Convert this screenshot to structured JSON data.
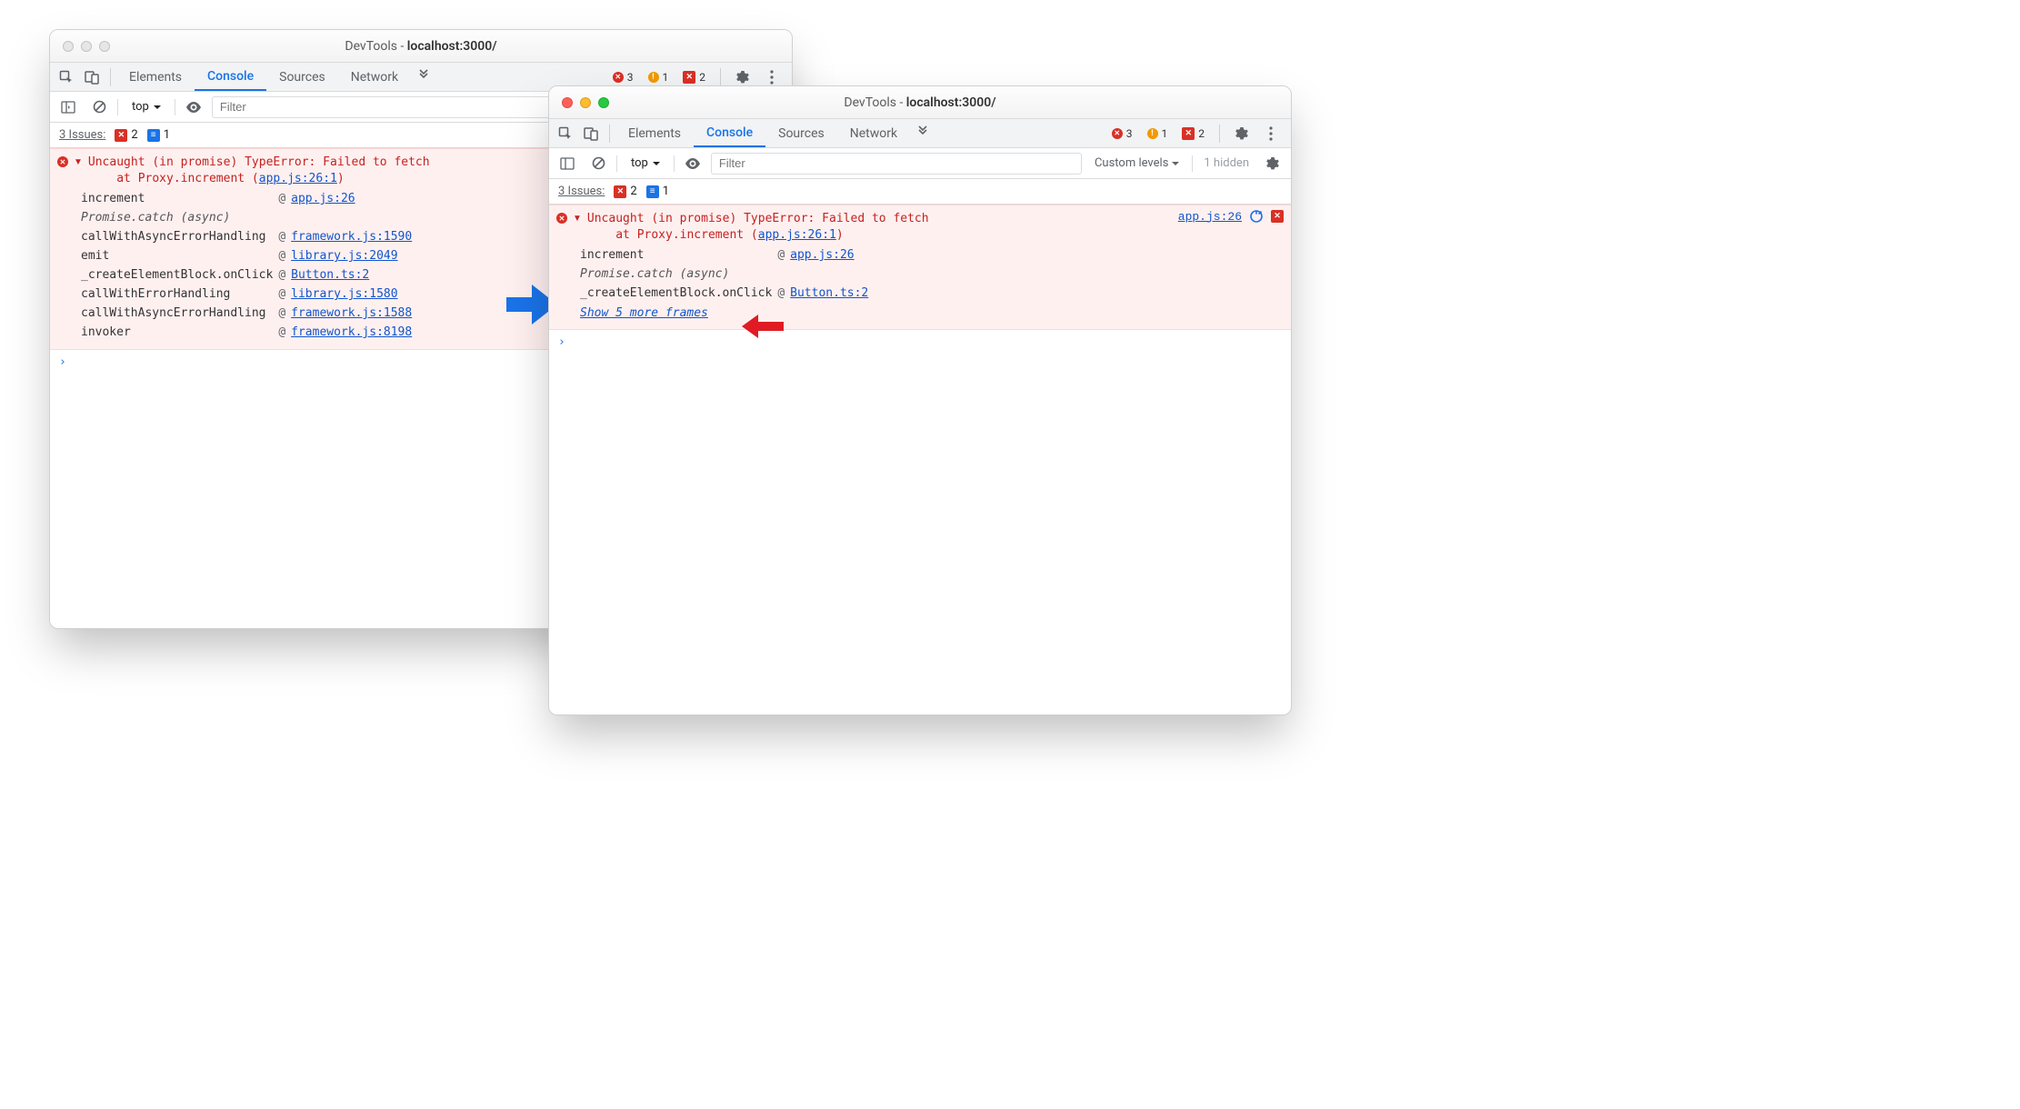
{
  "titlePrefix": "DevTools - ",
  "titleHost": "localhost:3000/",
  "tabs": {
    "elements": "Elements",
    "console": "Console",
    "sources": "Sources",
    "network": "Network"
  },
  "counts": {
    "errors": "3",
    "warnings": "1",
    "breakpoints": "2"
  },
  "sub": {
    "context": "top",
    "filterPlaceholder": "Filter",
    "levels": "Custom levels",
    "hidden": "1 hidden"
  },
  "issues": {
    "label": "3 Issues:",
    "bpCount": "2",
    "chatCount": "1"
  },
  "error": {
    "head": "Uncaught (in promise) TypeError: Failed to fetch",
    "at": "at Proxy.increment (",
    "loc": "app.js:26:1",
    "metaLoc": "app.js:26"
  },
  "stackA": [
    {
      "fn": "increment",
      "at": "@",
      "loc": "app.js:26"
    },
    {
      "fn": "Promise.catch (async)",
      "async": true
    },
    {
      "fn": "callWithAsyncErrorHandling",
      "at": "@",
      "loc": "framework.js:1590"
    },
    {
      "fn": "emit",
      "at": "@",
      "loc": "library.js:2049"
    },
    {
      "fn": "_createElementBlock.onClick",
      "at": "@",
      "loc": "Button.ts:2"
    },
    {
      "fn": "callWithErrorHandling",
      "at": "@",
      "loc": "library.js:1580"
    },
    {
      "fn": "callWithAsyncErrorHandling",
      "at": "@",
      "loc": "framework.js:1588"
    },
    {
      "fn": "invoker",
      "at": "@",
      "loc": "framework.js:8198"
    }
  ],
  "stackB": [
    {
      "fn": "increment",
      "at": "@",
      "loc": "app.js:26"
    },
    {
      "fn": "Promise.catch (async)",
      "async": true
    },
    {
      "fn": "_createElementBlock.onClick",
      "at": "@",
      "loc": "Button.ts:2"
    }
  ],
  "showMore": "Show 5 more frames"
}
